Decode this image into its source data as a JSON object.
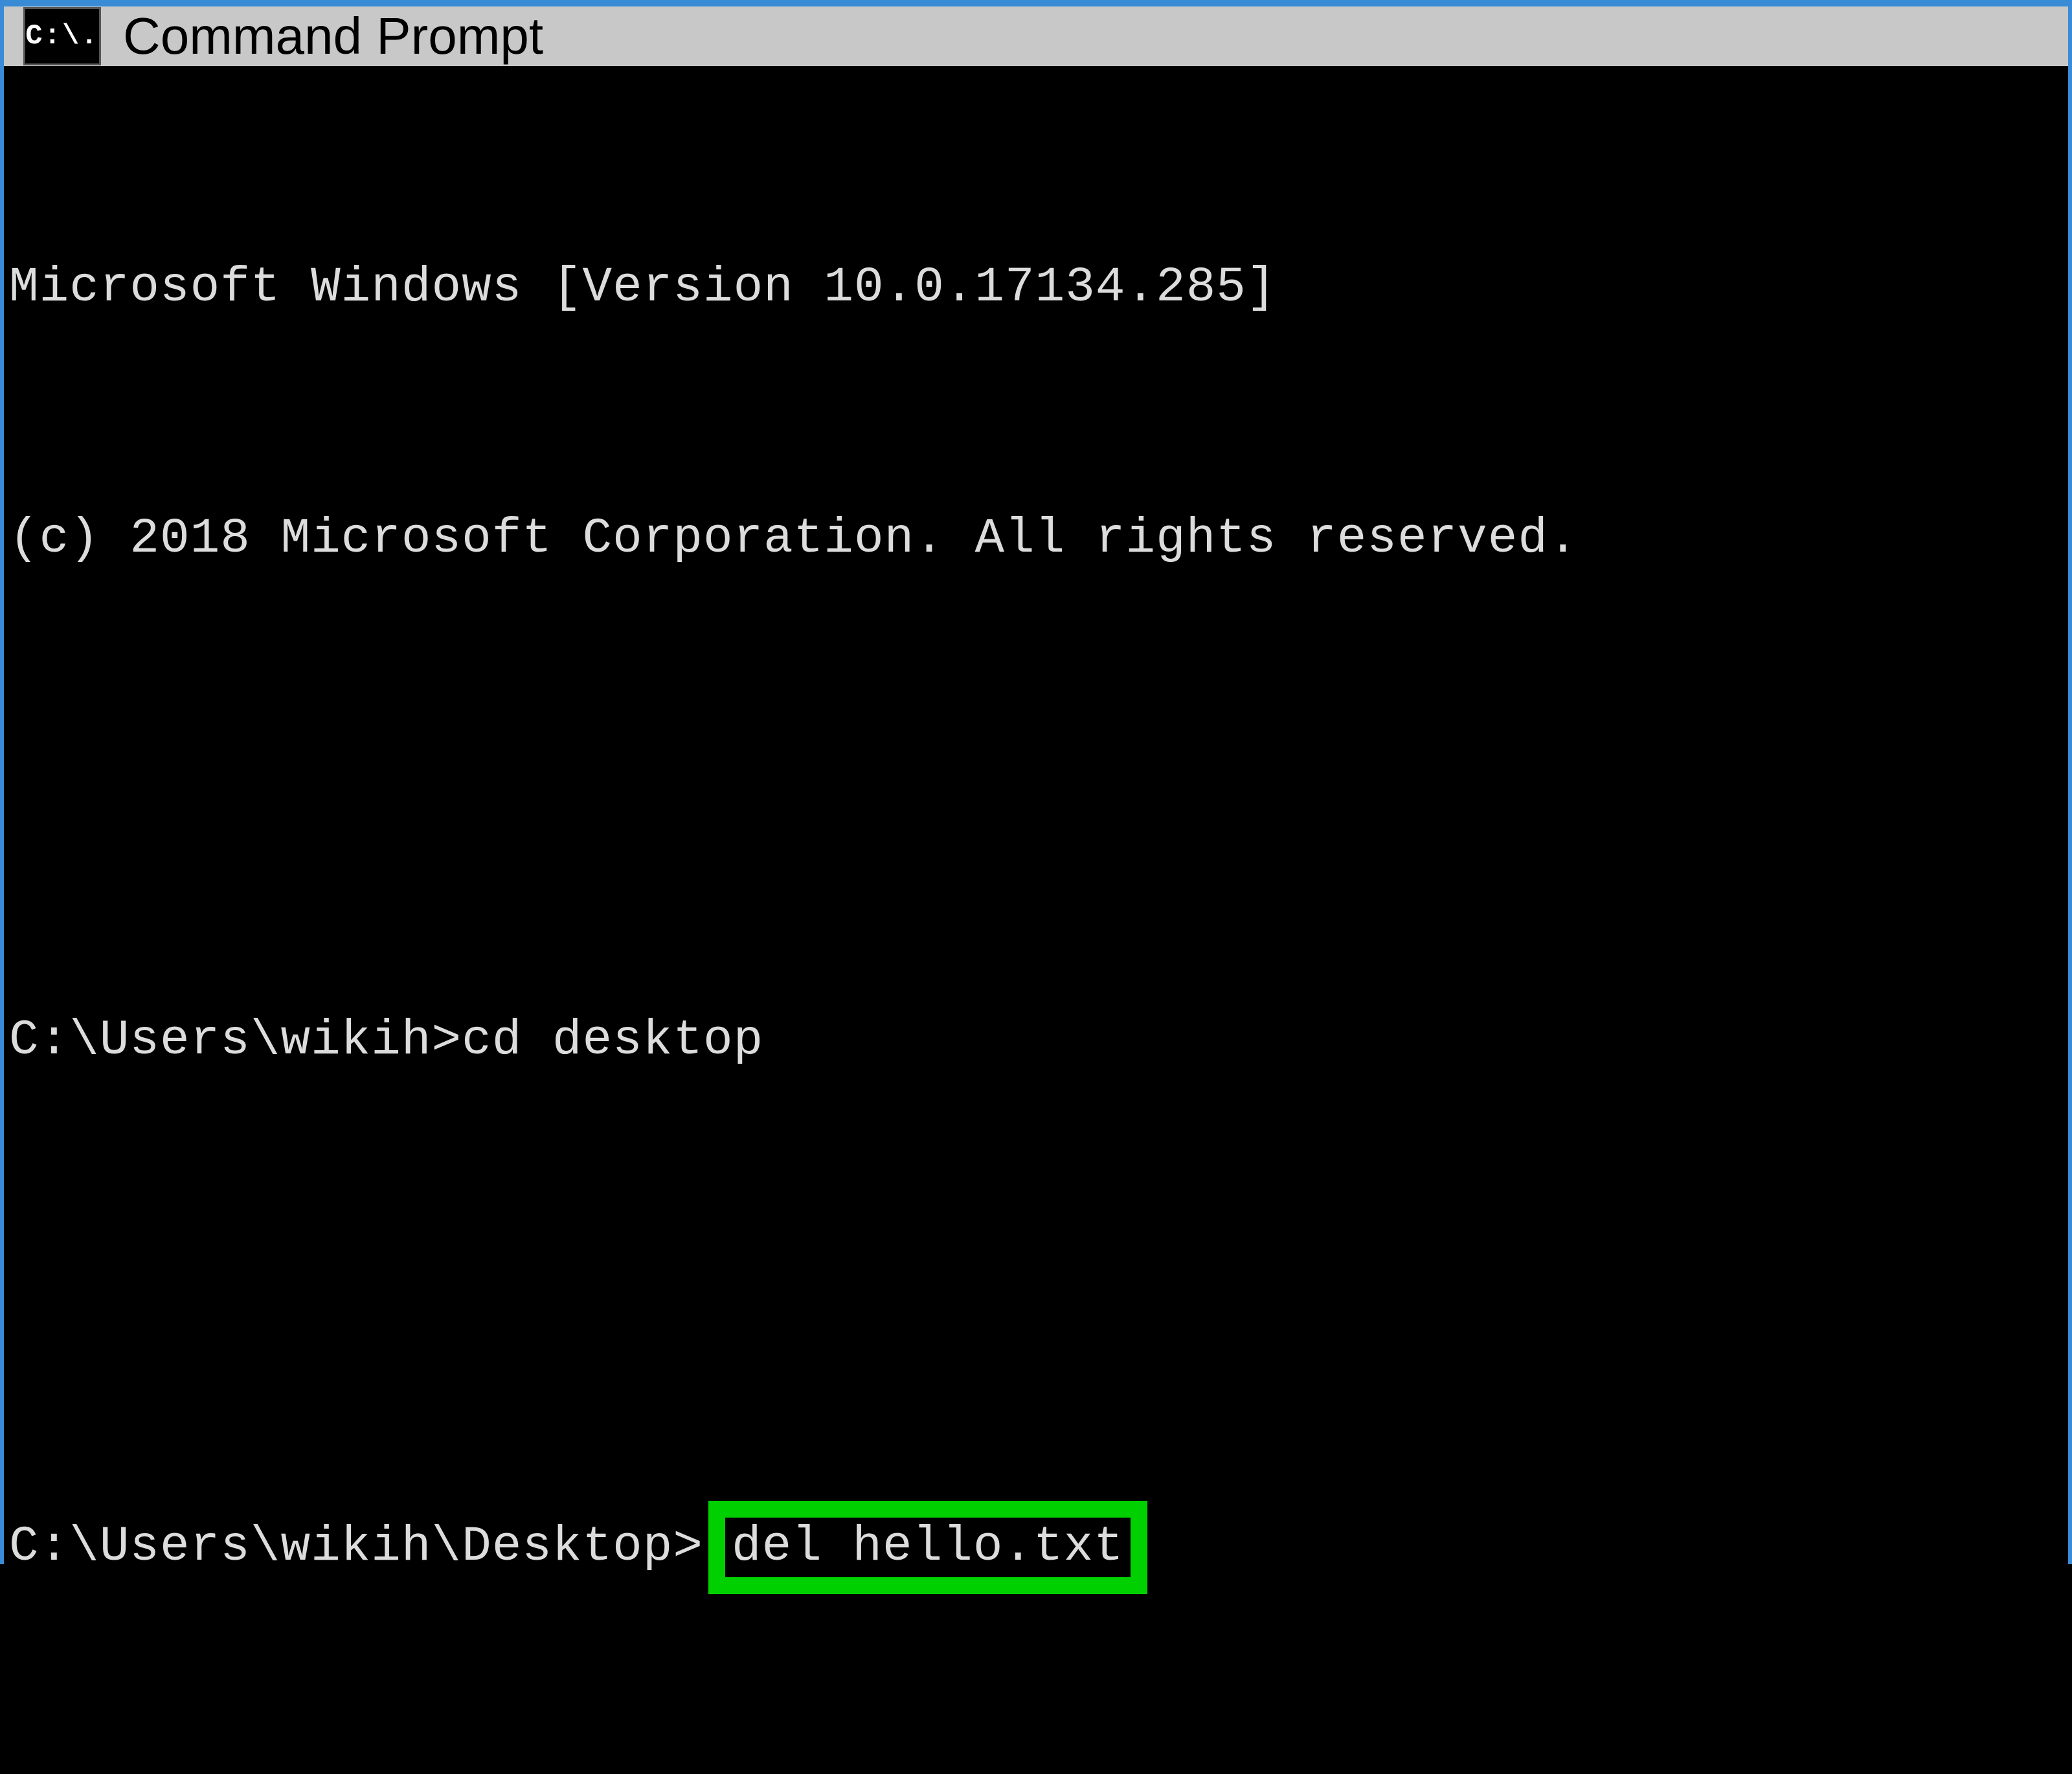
{
  "window": {
    "title": "Command Prompt",
    "icon_label": "C:\\."
  },
  "terminal": {
    "line1": "Microsoft Windows [Version 10.0.17134.285]",
    "line2": "(c) 2018 Microsoft Corporation. All rights reserved.",
    "prompt1": "C:\\Users\\wikih>cd desktop",
    "prompt2_prefix": "C:\\Users\\wikih\\Desktop>",
    "highlighted_command": "del hello.txt"
  },
  "colors": {
    "highlight_border": "#00d000",
    "window_border": "#3a8bd6",
    "titlebar_bg": "#c8c8c8",
    "terminal_bg": "#000000",
    "terminal_fg": "#dcdcdc"
  }
}
